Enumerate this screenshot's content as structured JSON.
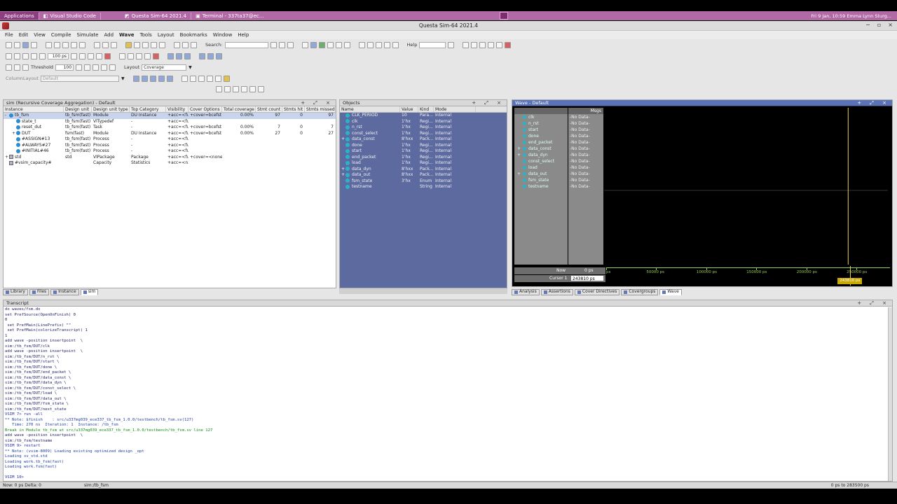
{
  "taskbar": {
    "items": [
      {
        "label": "Applications"
      },
      {
        "label": "Visual Studio Code"
      },
      {
        "label": "Questa Sim-64 2021.4"
      },
      {
        "label": "Terminal - 337ta37@ec..."
      }
    ],
    "clock": "Fri 9 Jan, 10:59  Emma Lynn Sturg..."
  },
  "window": {
    "title": "Questa Sim-64 2021.4"
  },
  "menu": [
    "File",
    "Edit",
    "View",
    "Compile",
    "Simulate",
    "Add",
    "Wave",
    "Tools",
    "Layout",
    "Bookmarks",
    "Window",
    "Help"
  ],
  "toolbar": {
    "search_label": "Search:",
    "help_label": "Help",
    "run_length": "100 ps",
    "threshold_label": "Threshold",
    "threshold_value": "100",
    "layout_label": "Layout",
    "layout_value": "Coverage",
    "column_layout_label": "ColumnLayout",
    "column_layout_value": "Default"
  },
  "instance_pane": {
    "title": "sim (Recursive Coverage Aggregation) - Default",
    "columns": [
      "Instance",
      "Design unit",
      "Design unit type",
      "Top Category",
      "Visibility",
      "Cover Options",
      "Total coverage",
      "Stmt count",
      "Stmts hit",
      "Stmts missed"
    ],
    "rows": [
      {
        "name": "tb_fsm",
        "unit": "tb_fsm(fast)",
        "type": "Module",
        "cat": "DU Instance",
        "vis": "+acc=<fu...",
        "cov": "+cover=bcefst",
        "total": "0.00%",
        "count": "97",
        "hit": "0",
        "missed": "97",
        "indent": 0,
        "twist": "-",
        "sel": true,
        "icon": "module"
      },
      {
        "name": "state_t",
        "unit": "tb_fsm(fast)",
        "type": "VlTypedef",
        "cat": "-",
        "vis": "+acc=<fu...",
        "cov": "",
        "total": "",
        "count": "",
        "hit": "",
        "missed": "",
        "indent": 1,
        "twist": "",
        "sel": false,
        "icon": "module"
      },
      {
        "name": "reset_dut",
        "unit": "tb_fsm(fast)",
        "type": "Task",
        "cat": "-",
        "vis": "+acc=<fu...",
        "cov": "+cover=bcefst",
        "total": "0.00%",
        "count": "7",
        "hit": "0",
        "missed": "7",
        "indent": 1,
        "twist": "",
        "sel": false,
        "icon": "module"
      },
      {
        "name": "DUT",
        "unit": "fsm(fast)",
        "type": "Module",
        "cat": "DU Instance",
        "vis": "+acc=<fu...",
        "cov": "+cover=bcefst",
        "total": "0.00%",
        "count": "27",
        "hit": "0",
        "missed": "27",
        "indent": 1,
        "twist": "+",
        "sel": false,
        "icon": "module"
      },
      {
        "name": "#ASSIGN#13",
        "unit": "tb_fsm(fast)",
        "type": "Process",
        "cat": "-",
        "vis": "+acc=<fu...",
        "cov": "",
        "total": "",
        "count": "",
        "hit": "",
        "missed": "",
        "indent": 1,
        "twist": "",
        "sel": false,
        "icon": "module"
      },
      {
        "name": "#ALWAYS#27",
        "unit": "tb_fsm(fast)",
        "type": "Process",
        "cat": "-",
        "vis": "+acc=<fu...",
        "cov": "",
        "total": "",
        "count": "",
        "hit": "",
        "missed": "",
        "indent": 1,
        "twist": "",
        "sel": false,
        "icon": "module"
      },
      {
        "name": "#INITIAL#46",
        "unit": "tb_fsm(fast)",
        "type": "Process",
        "cat": "-",
        "vis": "+acc=<fu...",
        "cov": "",
        "total": "",
        "count": "",
        "hit": "",
        "missed": "",
        "indent": 1,
        "twist": "",
        "sel": false,
        "icon": "module"
      },
      {
        "name": "std",
        "unit": "std",
        "type": "VlPackage",
        "cat": "Package",
        "vis": "+acc=<fu...",
        "cov": "+cover=<none>",
        "total": "",
        "count": "",
        "hit": "",
        "missed": "",
        "indent": 0,
        "twist": "+",
        "sel": false,
        "icon": "package"
      },
      {
        "name": "#vsim_capacity#",
        "unit": "",
        "type": "Capacity",
        "cat": "Statistics",
        "vis": "+acc=<n...",
        "cov": "",
        "total": "",
        "count": "",
        "hit": "",
        "missed": "",
        "indent": 0,
        "twist": "",
        "sel": false,
        "icon": "package"
      }
    ],
    "tabs": [
      "Library",
      "Files",
      "Instance",
      "sim"
    ]
  },
  "objects_pane": {
    "title": "Objects",
    "columns": [
      "Name",
      "Value",
      "Kind",
      "Mode"
    ],
    "rows": [
      {
        "name": "CLK_PERIOD",
        "value": "10",
        "kind": "Para...",
        "mode": "Internal",
        "twist": ""
      },
      {
        "name": "clk",
        "value": "1'hx",
        "kind": "Regi...",
        "mode": "Internal",
        "twist": ""
      },
      {
        "name": "n_rst",
        "value": "1'hx",
        "kind": "Regi...",
        "mode": "Internal",
        "twist": ""
      },
      {
        "name": "const_select",
        "value": "1'hx",
        "kind": "Regi...",
        "mode": "Internal",
        "twist": ""
      },
      {
        "name": "data_const",
        "value": "8'hxx",
        "kind": "Pack...",
        "mode": "Internal",
        "twist": "+"
      },
      {
        "name": "done",
        "value": "1'hx",
        "kind": "Regi...",
        "mode": "Internal",
        "twist": ""
      },
      {
        "name": "start",
        "value": "1'hx",
        "kind": "Regi...",
        "mode": "Internal",
        "twist": ""
      },
      {
        "name": "end_packet",
        "value": "1'hx",
        "kind": "Regi...",
        "mode": "Internal",
        "twist": ""
      },
      {
        "name": "load",
        "value": "1'hx",
        "kind": "Regi...",
        "mode": "Internal",
        "twist": ""
      },
      {
        "name": "data_dyn",
        "value": "8'hxx",
        "kind": "Pack...",
        "mode": "Internal",
        "twist": "+"
      },
      {
        "name": "data_out",
        "value": "8'hxx",
        "kind": "Pack...",
        "mode": "Internal",
        "twist": "+"
      },
      {
        "name": "fsm_state",
        "value": "3'hx",
        "kind": "Enum",
        "mode": "Internal",
        "twist": ""
      },
      {
        "name": "testname",
        "value": "",
        "kind": "String",
        "mode": "Internal",
        "twist": ""
      }
    ]
  },
  "wave_pane": {
    "title": "Wave - Default",
    "msgs_label": "Msgs",
    "signals": [
      {
        "name": "clk",
        "value": "-No Data-",
        "twist": ""
      },
      {
        "name": "n_rst",
        "value": "-No Data-",
        "twist": ""
      },
      {
        "name": "start",
        "value": "-No Data-",
        "twist": ""
      },
      {
        "name": "done",
        "value": "-No Data-",
        "twist": ""
      },
      {
        "name": "end_packet",
        "value": "-No Data-",
        "twist": ""
      },
      {
        "name": "data_const",
        "value": "-No Data-",
        "twist": "+"
      },
      {
        "name": "data_dyn",
        "value": "-No Data-",
        "twist": "+"
      },
      {
        "name": "const_select",
        "value": "-No Data-",
        "twist": ""
      },
      {
        "name": "load",
        "value": "-No Data-",
        "twist": ""
      },
      {
        "name": "data_out",
        "value": "-No Data-",
        "twist": "+"
      },
      {
        "name": "fsm_state",
        "value": "-No Data-",
        "twist": ""
      },
      {
        "name": "testname",
        "value": "-No Data-",
        "twist": ""
      }
    ],
    "now_label": "Now",
    "now_value": "0 ps",
    "cursor_label": "Cursor 1",
    "cursor_value": "243810 ps",
    "cursor_time_ps": 243810,
    "range_ps": [
      0,
      283500
    ],
    "timeline_ticks": [
      {
        "label": "ps",
        "t": 0
      },
      {
        "label": "50000 ps",
        "t": 50000
      },
      {
        "label": "100000 ps",
        "t": 100000
      },
      {
        "label": "150000 ps",
        "t": 150000
      },
      {
        "label": "200000 ps",
        "t": 200000
      },
      {
        "label": "250000 ps",
        "t": 250000
      }
    ],
    "cursor_flag": "243810 ps",
    "tabs": [
      "Analysis",
      "Assertions",
      "Cover Directives",
      "Covergroups",
      "Wave"
    ]
  },
  "transcript": {
    "title": "Transcript",
    "lines": [
      {
        "text": "do waves/fsm.do",
        "cls": ""
      },
      {
        "text": "set PrefSource(OpenOnFinish) 0",
        "cls": ""
      },
      {
        "text": "0",
        "cls": ""
      },
      {
        "text": " set PrefMain(LinePrefix) \"\"",
        "cls": ""
      },
      {
        "text": " set PrefMain(colorizeTranscript) 1",
        "cls": ""
      },
      {
        "text": "1",
        "cls": ""
      },
      {
        "text": "add wave -position insertpoint  \\",
        "cls": ""
      },
      {
        "text": "sim:/tb_fsm/DUT/clk",
        "cls": ""
      },
      {
        "text": "add wave -position insertpoint  \\",
        "cls": ""
      },
      {
        "text": "sim:/tb_fsm/DUT/n_rst \\",
        "cls": ""
      },
      {
        "text": "sim:/tb_fsm/DUT/start \\",
        "cls": ""
      },
      {
        "text": "sim:/tb_fsm/DUT/done \\",
        "cls": ""
      },
      {
        "text": "sim:/tb_fsm/DUT/end_packet \\",
        "cls": ""
      },
      {
        "text": "sim:/tb_fsm/DUT/data_const \\",
        "cls": ""
      },
      {
        "text": "sim:/tb_fsm/DUT/data_dyn \\",
        "cls": ""
      },
      {
        "text": "sim:/tb_fsm/DUT/const_select \\",
        "cls": ""
      },
      {
        "text": "sim:/tb_fsm/DUT/load \\",
        "cls": ""
      },
      {
        "text": "sim:/tb_fsm/DUT/data_out \\",
        "cls": ""
      },
      {
        "text": "sim:/tb_fsm/DUT/fsm_state \\",
        "cls": ""
      },
      {
        "text": "sim:/tb_fsm/DUT/next_state",
        "cls": ""
      },
      {
        "text": "VSIM 7> run -all",
        "cls": "vsim"
      },
      {
        "text": "** Note: $finish    : src/u337mg039_ece337_tb_fsm_1.0.0/testbench/tb_fsm.sv(127)",
        "cls": "note"
      },
      {
        "text": "   Time: 270 ns  Iteration: 1  Instance: /tb_fsm",
        "cls": "note"
      },
      {
        "text": "Break in Module tb_fsm at src/u337mg039_ece337_tb_fsm_1.0.0/testbench/tb_fsm.sv line 127",
        "cls": "green"
      },
      {
        "text": "add wave -position insertpoint  \\",
        "cls": ""
      },
      {
        "text": "sim:/tb_fsm/testname",
        "cls": ""
      },
      {
        "text": "VSIM 9> restart",
        "cls": "vsim"
      },
      {
        "text": "** Note: (vsim-8009) Loading existing optimized design _opt",
        "cls": "note"
      },
      {
        "text": "Loading sv_std.std",
        "cls": "note"
      },
      {
        "text": "Loading work.tb_fsm(fast)",
        "cls": "note"
      },
      {
        "text": "Loading work.fsm(fast)",
        "cls": "note"
      },
      {
        "text": "",
        "cls": ""
      },
      {
        "text": "VSIM 10>",
        "cls": "vsim"
      }
    ]
  },
  "statusbar": {
    "now": "Now: 0 ps  Delta: 0",
    "context": "sim:/tb_fsm",
    "range": "0 ps to 283500 ps"
  }
}
